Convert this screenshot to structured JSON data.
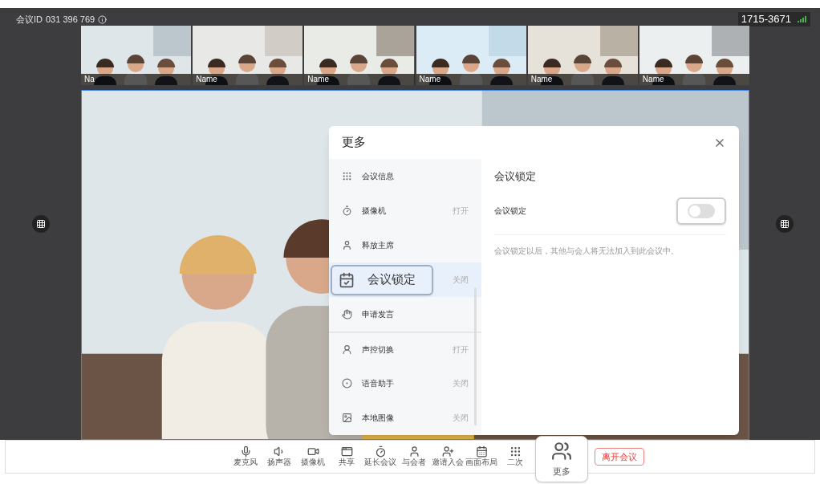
{
  "meeting_id": {
    "label": "会议ID",
    "value": "031 396 769"
  },
  "room_code": "1715-3671",
  "thumbnails": [
    {
      "name": "Na"
    },
    {
      "name": "Name"
    },
    {
      "name": "Name"
    },
    {
      "name": "Name"
    },
    {
      "name": "Name"
    },
    {
      "name": "Name"
    }
  ],
  "more_dialog": {
    "title": "更多",
    "menu": [
      {
        "label": "会议信息",
        "selected": false
      },
      {
        "label": "摄像机",
        "status": "打开",
        "selected": false
      },
      {
        "label": "释放主席",
        "selected": false
      },
      {
        "label": "会议锁定",
        "status": "关闭",
        "selected": true
      },
      {
        "label": "申请发言",
        "selected": false
      },
      {
        "label": "声控切换",
        "status": "打开",
        "selected": false
      },
      {
        "label": "语音助手",
        "status": "关闭",
        "selected": false
      },
      {
        "label": "本地图像",
        "status": "关闭",
        "selected": false
      }
    ],
    "detail": {
      "title": "会议锁定",
      "setting": {
        "label": "会议锁定",
        "on": false
      },
      "description": "会议锁定以后，其他与会人将无法加入到此会议中。"
    }
  },
  "toolbar": [
    {
      "label": "麦克风"
    },
    {
      "label": "扬声器"
    },
    {
      "label": "摄像机"
    },
    {
      "label": "共享"
    },
    {
      "label": "延长会议"
    },
    {
      "label": "与会者"
    },
    {
      "label": "邀请入会"
    },
    {
      "label": "画面布局"
    },
    {
      "label": "二次"
    }
  ],
  "more_button": {
    "label": "更多"
  },
  "leave_button": {
    "label": "离开会议"
  }
}
